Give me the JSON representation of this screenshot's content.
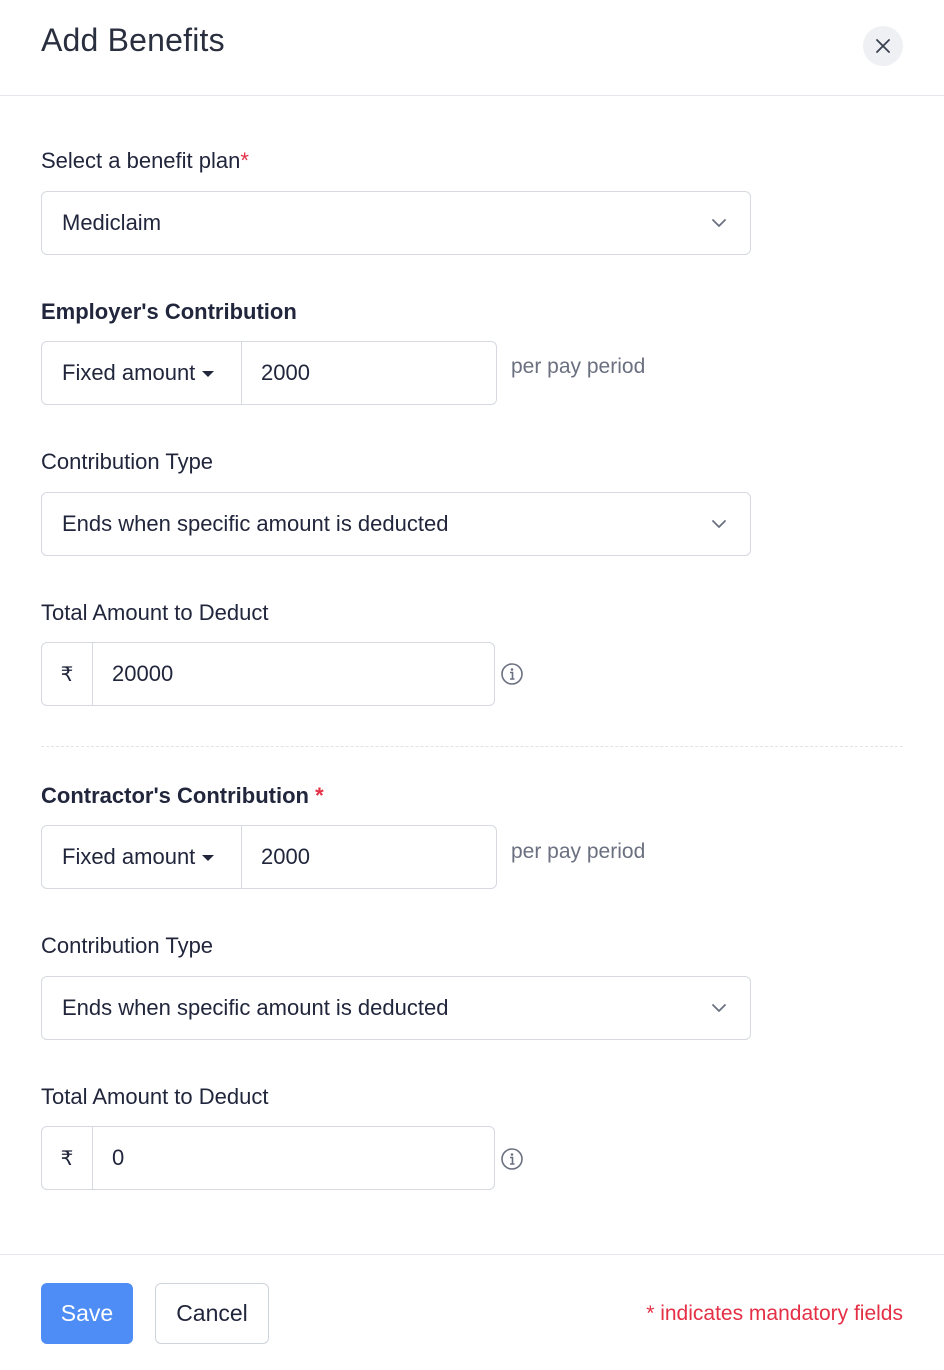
{
  "header": {
    "title": "Add Benefits",
    "close_icon": "close-icon"
  },
  "benefit_plan": {
    "label": "Select a benefit plan",
    "required_mark": "*",
    "value": "Mediclaim"
  },
  "employer": {
    "heading": "Employer's Contribution",
    "type_value": "Fixed amount",
    "amount_value": "2000",
    "suffix": "per pay period",
    "contribution_type_label": "Contribution Type",
    "contribution_type_value": "Ends when specific amount is deducted",
    "total_label": "Total Amount to Deduct",
    "currency_symbol": "₹",
    "total_value": "20000"
  },
  "contractor": {
    "heading": "Contractor's Contribution",
    "required_mark": "*",
    "type_value": "Fixed amount",
    "amount_value": "2000",
    "suffix": "per pay period",
    "contribution_type_label": "Contribution Type",
    "contribution_type_value": "Ends when specific amount is deducted",
    "total_label": "Total Amount to Deduct",
    "currency_symbol": "₹",
    "total_value": "0"
  },
  "footer": {
    "save_label": "Save",
    "cancel_label": "Cancel",
    "mandatory_note": "* indicates mandatory fields"
  },
  "colors": {
    "accent": "#4d8df5",
    "required": "#e42f45",
    "border": "#d6d9e0"
  }
}
